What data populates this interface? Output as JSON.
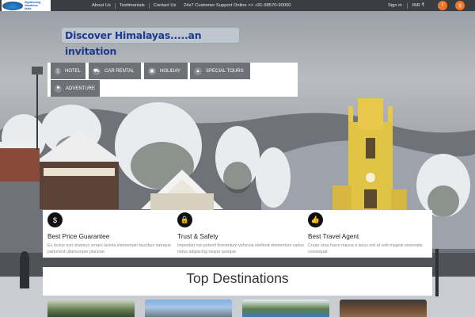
{
  "topbar": {
    "logo_text_1": "Sightseeing",
    "logo_text_2": "Vacations",
    "logo_text_3": "India",
    "nav": [
      "About Us",
      "Testimonials",
      "Contact Us"
    ],
    "support": "24x7 Customer Support Online >> +91-98570-90000",
    "signin": "Sign in",
    "currency": "INR ₹",
    "social": [
      {
        "icon": "facebook-icon",
        "glyph": "f"
      },
      {
        "icon": "google-plus-icon",
        "glyph": "g"
      }
    ],
    "social_color": "#f0772a"
  },
  "tagline": "Discover Himalayas.....an invitation",
  "tabs": [
    {
      "label": "Hotel",
      "icon": "hotel-icon",
      "glyph": "▯"
    },
    {
      "label": "Car Rental",
      "icon": "car-icon",
      "glyph": "⛟"
    },
    {
      "label": "Holiday",
      "icon": "holiday-icon",
      "glyph": "▣"
    },
    {
      "label": "Special Tours",
      "icon": "tours-icon",
      "glyph": "▲"
    },
    {
      "label": "Adventure",
      "icon": "adventure-icon",
      "glyph": "⚑"
    }
  ],
  "features": [
    {
      "icon": "dollar-icon",
      "glyph": "$",
      "title": "Best Price Guarantee",
      "desc": "Eu lectus non vivamus ornare lacinia elementum faucibus natoque parturient ullamcorper placerat"
    },
    {
      "icon": "lock-icon",
      "glyph": "🔒",
      "title": "Trust & Safety",
      "desc": "Imperdiet nisi potenti fermentum vehicula eleifend elementum varius netus adipiscing neque quisque"
    },
    {
      "icon": "thumbs-up-icon",
      "glyph": "👍",
      "title": "Best Travel Agent",
      "desc": "Curae urna fusce massa a lacus nisl id velit magnis venenatis consequat"
    }
  ],
  "destinations_title": "Top Destinations"
}
